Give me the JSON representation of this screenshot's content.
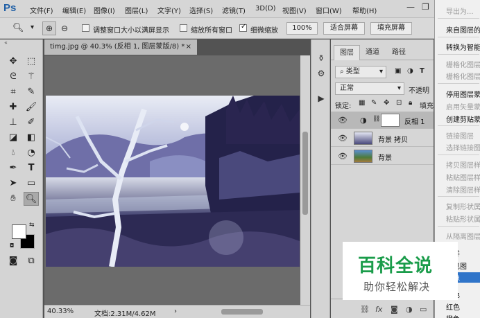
{
  "app": {
    "logo": "Ps"
  },
  "menubar": {
    "items": [
      "文件(F)",
      "编辑(E)",
      "图像(I)",
      "图层(L)",
      "文字(Y)",
      "选择(S)",
      "滤镜(T)",
      "3D(D)",
      "视图(V)",
      "窗口(W)",
      "帮助(H)"
    ],
    "minimize": "—",
    "restore": "❐"
  },
  "options": {
    "resize_windows_label": "调整窗口大小以满屏显示",
    "zoom_all_label": "缩放所有窗口",
    "scrubby_zoom_label": "细微缩放",
    "scrubby_zoom_checked": true,
    "btn_100": "100%",
    "btn_fit": "适合屏幕",
    "btn_fill": "填充屏幕"
  },
  "document": {
    "tab_title": "timg.jpg @ 40.3% (反相 1, 图层蒙版/8) *",
    "zoom": "40.33%",
    "doc_size": "文档:2.31M/4.62M"
  },
  "layers_panel": {
    "tabs": [
      "图层",
      "通道",
      "路径"
    ],
    "filter_kind": "类型",
    "blend_mode": "正常",
    "opacity_label": "不透明",
    "lock_label": "锁定:",
    "fill_label": "填充",
    "layers": [
      {
        "name": "反相 1",
        "active": true
      },
      {
        "name": "背景 拷贝",
        "active": false
      },
      {
        "name": "背景",
        "active": false
      }
    ]
  },
  "context_menu": {
    "items": [
      {
        "label": "导出为...",
        "disabled": true
      },
      {
        "label": "来自图层的",
        "disabled": false
      },
      {
        "label": "转换为智能",
        "disabled": false
      },
      {
        "label": "栅格化图层",
        "disabled": true
      },
      {
        "label": "栅格化图层",
        "disabled": true
      },
      {
        "label": "停用图层蒙",
        "disabled": false
      },
      {
        "label": "启用矢量蒙",
        "disabled": true
      },
      {
        "label": "创建剪贴蒙",
        "disabled": false
      },
      {
        "label": "链接图层",
        "disabled": true
      },
      {
        "label": "选择链接图",
        "disabled": true
      },
      {
        "label": "拷贝图层样",
        "disabled": true
      },
      {
        "label": "粘贴图层样",
        "disabled": true
      },
      {
        "label": "清除图层样",
        "disabled": true
      },
      {
        "label": "复制形状属",
        "disabled": true
      },
      {
        "label": "粘贴形状属",
        "disabled": true
      },
      {
        "label": "从隔离图层",
        "disabled": true
      },
      {
        "label": "合并",
        "disabled": false
      },
      {
        "label": "可见图",
        "disabled": false
      },
      {
        "label": "图像",
        "disabled": false,
        "highlighted": true
      },
      {
        "label": "颜色",
        "disabled": false
      },
      {
        "label": "红色",
        "disabled": false
      },
      {
        "label": "橙色",
        "disabled": false
      }
    ]
  },
  "watermark": {
    "title": "百科全说",
    "subtitle": "助你轻松解决"
  },
  "colors": {
    "foreground": "#ffffff",
    "background": "#000000",
    "menu_highlight": "#2f74c9"
  }
}
